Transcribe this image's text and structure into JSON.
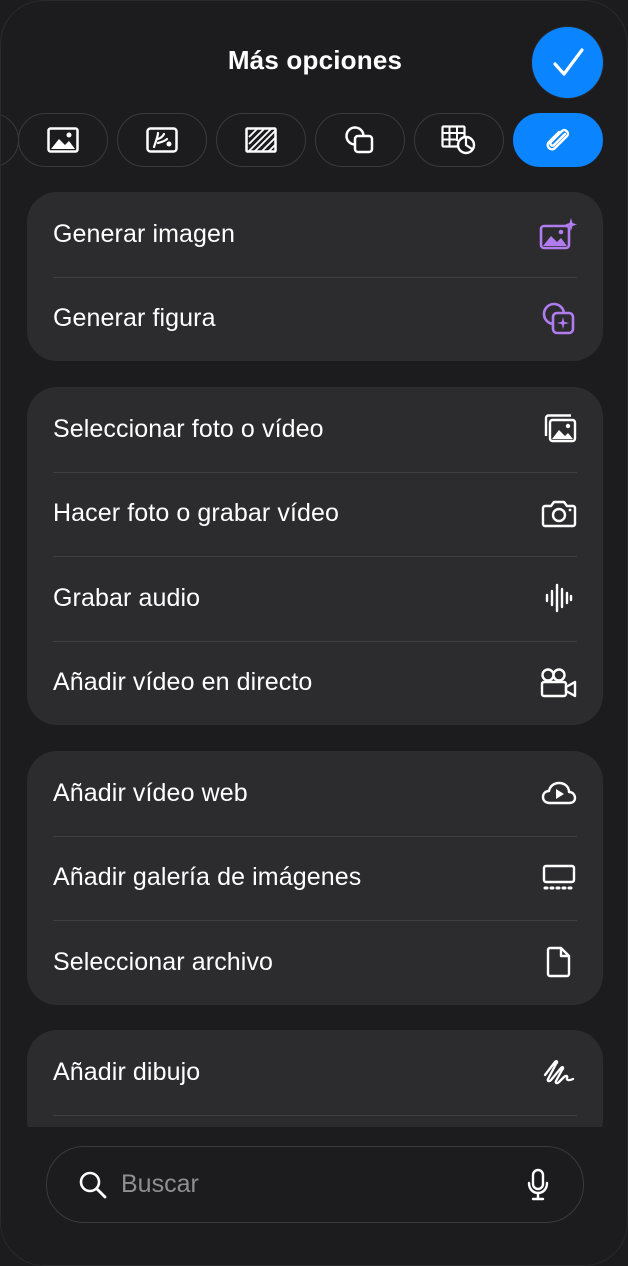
{
  "header": {
    "title": "Más opciones"
  },
  "colors": {
    "accent": "#0a84ff",
    "ai_purple": "#b07cf0",
    "card": "#2c2c2e",
    "background": "#1c1c1e"
  },
  "tabs": [
    {
      "icon": "partial-tab-icon",
      "active": false
    },
    {
      "icon": "image-icon",
      "active": false
    },
    {
      "icon": "media-sticker-icon",
      "active": false
    },
    {
      "icon": "hatched-rectangle-icon",
      "active": false
    },
    {
      "icon": "shapes-icon",
      "active": false
    },
    {
      "icon": "table-chart-icon",
      "active": false
    },
    {
      "icon": "paperclip-icon",
      "active": true
    }
  ],
  "groups": [
    {
      "items": [
        {
          "label": "Generar imagen",
          "icon": "image-sparkle-icon"
        },
        {
          "label": "Generar figura",
          "icon": "shape-sparkle-icon"
        }
      ]
    },
    {
      "items": [
        {
          "label": "Seleccionar foto o vídeo",
          "icon": "photos-icon"
        },
        {
          "label": "Hacer foto o grabar vídeo",
          "icon": "camera-icon"
        },
        {
          "label": "Grabar audio",
          "icon": "waveform-icon"
        },
        {
          "label": "Añadir vídeo en directo",
          "icon": "video-camera-icon"
        }
      ]
    },
    {
      "items": [
        {
          "label": "Añadir vídeo web",
          "icon": "cloud-play-icon"
        },
        {
          "label": "Añadir galería de imágenes",
          "icon": "gallery-icon"
        },
        {
          "label": "Seleccionar archivo",
          "icon": "document-icon"
        }
      ]
    },
    {
      "items": [
        {
          "label": "Añadir dibujo",
          "icon": "scribble-icon"
        }
      ]
    }
  ],
  "search": {
    "placeholder": "Buscar",
    "value": ""
  }
}
